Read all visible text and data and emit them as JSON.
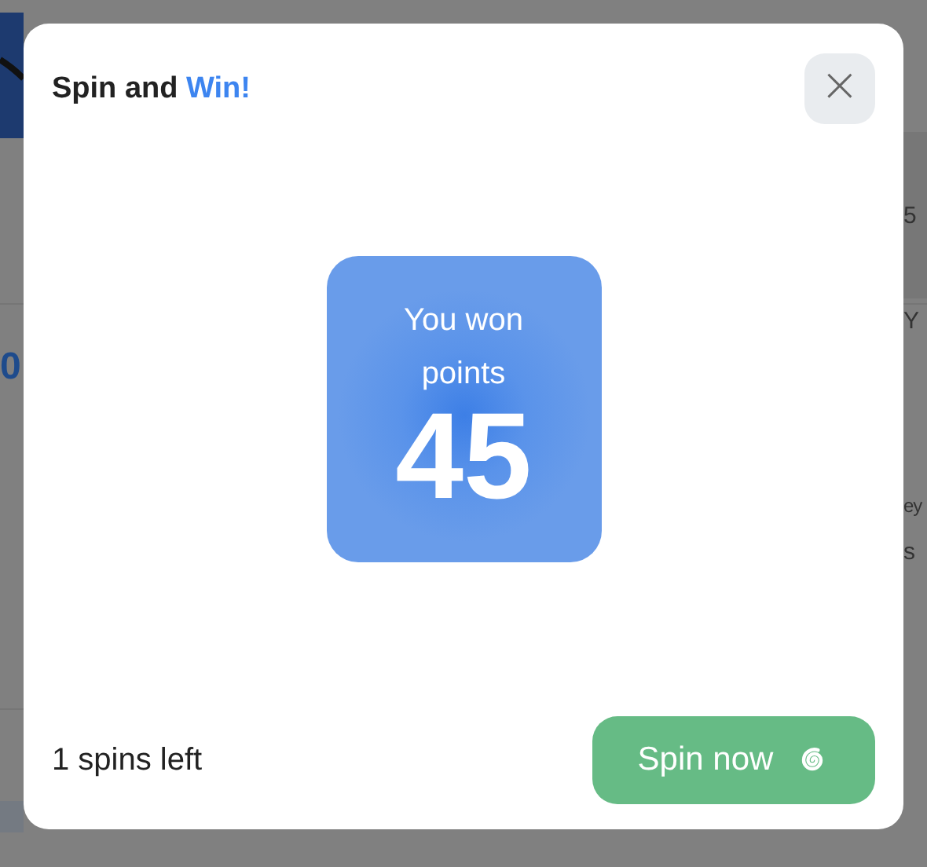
{
  "backdrop": {
    "left_text": "0",
    "right_texts": [
      "5",
      "Y",
      "ey",
      "s"
    ]
  },
  "dialog": {
    "title": "Spin and",
    "title_highlight": "Win!",
    "close_label": "×",
    "prize": {
      "caption": "You won points",
      "amount": "45"
    },
    "spins_left": "1 spins left",
    "spin_button": "Spin now"
  }
}
